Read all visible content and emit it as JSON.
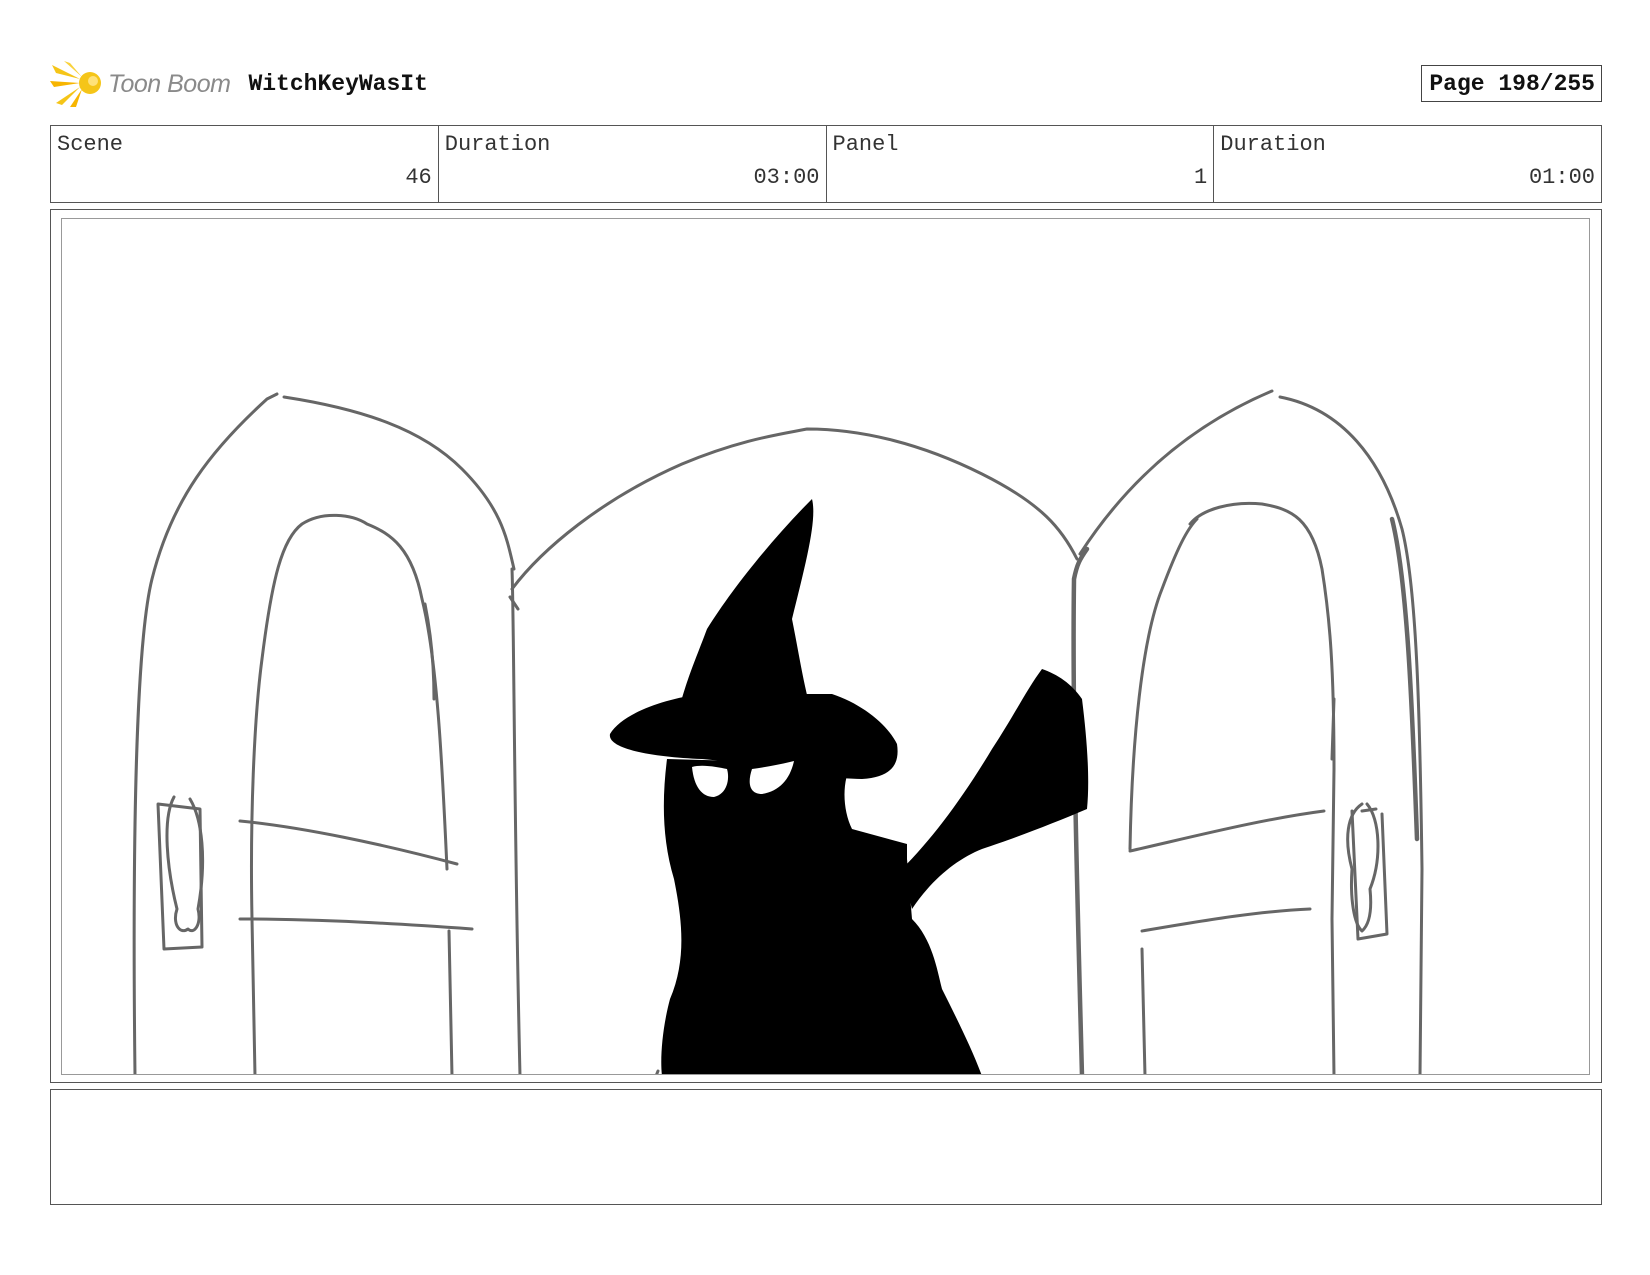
{
  "header": {
    "logo_text": "Toon Boom",
    "project_title": "WitchKeyWasIt",
    "page_label": "Page 198/255"
  },
  "info": [
    {
      "label": "Scene",
      "value": "46"
    },
    {
      "label": "Duration",
      "value": "03:00"
    },
    {
      "label": "Panel",
      "value": "1"
    },
    {
      "label": "Duration",
      "value": "01:00"
    }
  ],
  "panel": {
    "icon": "storyboard-sketch-witch-silhouette-between-open-doors"
  },
  "notes": {
    "text": ""
  },
  "colors": {
    "logo_yellow": "#f5c518",
    "logo_text": "#8a8a8a",
    "sketch_line": "#666666",
    "silhouette": "#000000"
  }
}
